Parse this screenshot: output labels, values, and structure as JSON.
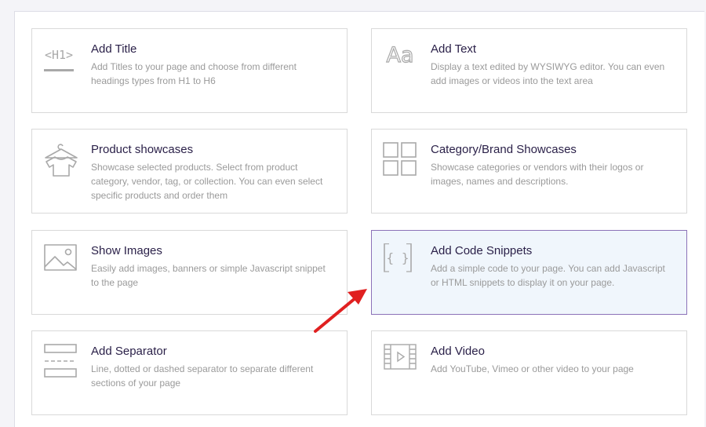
{
  "cards": [
    {
      "title": "Add Title",
      "desc": "Add Titles to your page and choose from different headings types from H1 to H6",
      "icon": "heading-h1-icon",
      "icon_text": "<H1>"
    },
    {
      "title": "Add Text",
      "desc": "Display a text edited by WYSIWYG editor. You can even add images or videos into the text area",
      "icon": "text-aa-icon",
      "icon_text": "Aa"
    },
    {
      "title": "Product showcases",
      "desc": "Showcase selected products. Select from product category, vendor, tag, or collection. You can even select specific products and order them",
      "icon": "tshirt-hanger-icon"
    },
    {
      "title": "Category/Brand Showcases",
      "desc": "Showcase categories or vendors with their logos or images, names and descriptions.",
      "icon": "grid-icon"
    },
    {
      "title": "Show Images",
      "desc": "Easily add images, banners or simple Javascript snippet to the page",
      "icon": "image-icon"
    },
    {
      "title": "Add Code Snippets",
      "desc": "Add a simple code to your page. You can add Javascript or HTML snippets to display it on your page.",
      "icon": "code-braces-icon",
      "icon_text": "{ }",
      "selected": true
    },
    {
      "title": "Add Separator",
      "desc": "Line, dotted or dashed separator to separate different sections of your page",
      "icon": "separator-icon"
    },
    {
      "title": "Add Video",
      "desc": "Add YouTube, Vimeo or other video to your page",
      "icon": "video-film-icon"
    }
  ],
  "colors": {
    "title": "#2b2149",
    "description": "#9a9a9a",
    "icon": "#a9a9a9",
    "selected_background": "#f0f6fc",
    "selected_border": "#8c72b8",
    "arrow": "#e02020"
  }
}
